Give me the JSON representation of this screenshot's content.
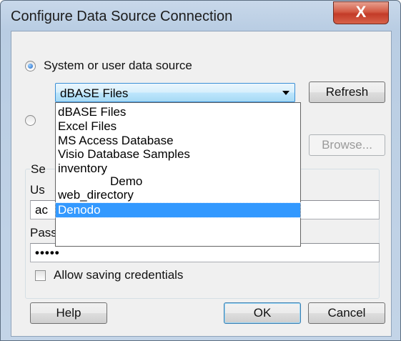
{
  "window": {
    "title": "Configure Data Source Connection",
    "close_label": "X"
  },
  "source_option": {
    "system_label": "System or user data source",
    "selected_source": "dBASE Files",
    "refresh_label": "Refresh",
    "browse_label": "Browse..."
  },
  "dropdown": {
    "items": [
      "dBASE Files",
      "Excel Files",
      "MS Access Database",
      "Visio Database Samples",
      "inventory",
      "Demo",
      "web_directory",
      "Denodo"
    ],
    "selected_index": 7
  },
  "credentials": {
    "group_title_visible": "Se",
    "user_label_visible": "Us",
    "user_value_visible": "ac",
    "password_label": "Password:",
    "password_value": "•••••",
    "allow_saving_label": "Allow saving credentials"
  },
  "buttons": {
    "help": "Help",
    "ok": "OK",
    "cancel": "Cancel"
  },
  "colors": {
    "selection": "#3399ff",
    "close_button": "#c9402b",
    "frame": "#b9cde3"
  }
}
